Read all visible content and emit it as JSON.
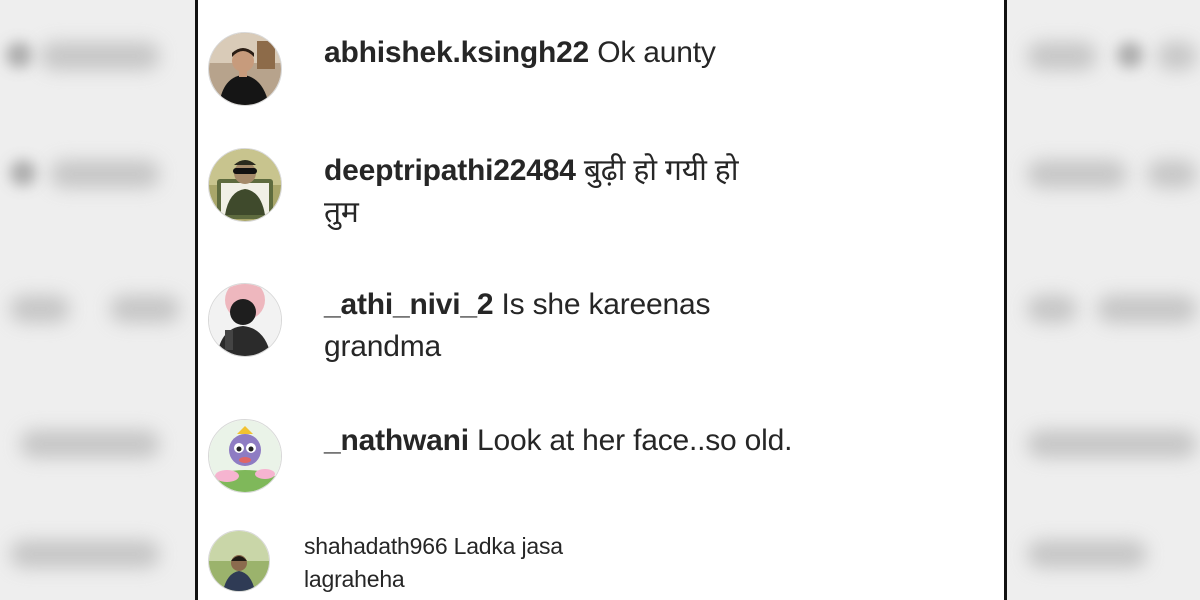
{
  "comments": [
    {
      "username": "abhishek.ksingh22",
      "text": "Ok aunty",
      "avatar": "avatar-man-black-shirt"
    },
    {
      "username": "deeptripathi22484",
      "text": "बुढ़ी हो गयी हो",
      "text_line2": "तुम",
      "avatar": "avatar-man-sunglasses"
    },
    {
      "username": "_athi_nivi_2",
      "text": "Is she kareenas",
      "text_line2": "grandma",
      "avatar": "avatar-dark-silhouette"
    },
    {
      "username": "_nathwani",
      "text": "Look at her face..so old.",
      "avatar": "avatar-cartoon-character"
    },
    {
      "username": "shahadath966",
      "text": "Ladka jasa",
      "text_line2": "lagraheha",
      "avatar": "avatar-man-outdoor"
    }
  ],
  "colors": {
    "text": "#262626",
    "panel_border": "#111111",
    "background_blur": "#eeeeee"
  }
}
